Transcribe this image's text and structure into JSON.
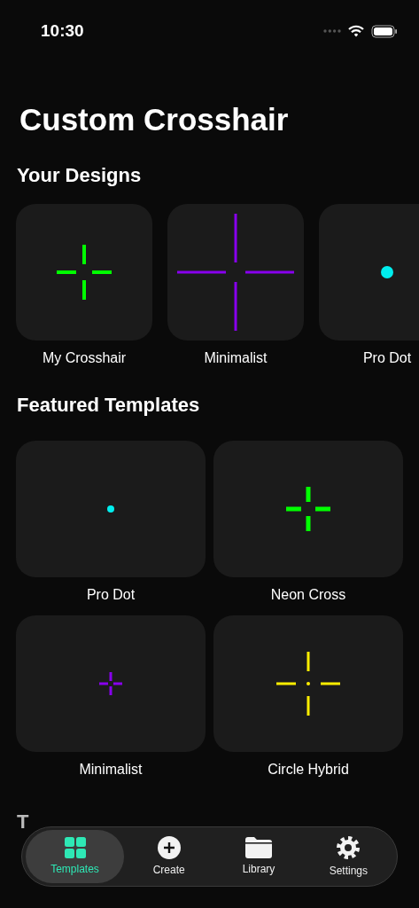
{
  "status_bar": {
    "time": "10:30"
  },
  "title": "Custom Crosshair",
  "your_designs": {
    "heading": "Your Designs",
    "items": [
      {
        "name": "My Crosshair",
        "kind": "cross",
        "color": "#00ff00"
      },
      {
        "name": "Minimalist",
        "kind": "long-cross",
        "color": "#8800ee"
      },
      {
        "name": "Pro Dot",
        "kind": "dot",
        "color": "#00eeee"
      }
    ]
  },
  "featured_templates": {
    "heading": "Featured Templates",
    "items": [
      {
        "name": "Pro Dot",
        "kind": "small-dot",
        "color": "#00eeee"
      },
      {
        "name": "Neon Cross",
        "kind": "thick-cross",
        "color": "#00ff00"
      },
      {
        "name": "Minimalist",
        "kind": "small-cross",
        "color": "#8800ee"
      },
      {
        "name": "Circle Hybrid",
        "kind": "cross-dot",
        "color": "#ffee00"
      }
    ]
  },
  "next_section": {
    "heading": "T"
  },
  "tab_bar": [
    {
      "label": "Templates",
      "kind": "grid",
      "selected": true
    },
    {
      "label": "Create",
      "kind": "plus",
      "selected": false
    },
    {
      "label": "Library",
      "kind": "folder",
      "selected": false
    },
    {
      "label": "Settings",
      "kind": "gear",
      "selected": false
    }
  ]
}
